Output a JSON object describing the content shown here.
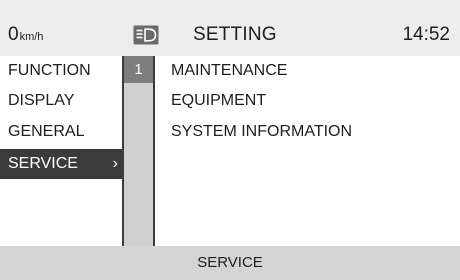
{
  "status": {
    "speed_value": "0",
    "speed_unit": "km/h",
    "headlight_icon": "low-beam-headlight-icon",
    "title": "SETTING",
    "clock": "14:52"
  },
  "categories": [
    {
      "label": "FUNCTION"
    },
    {
      "label": "DISPLAY"
    },
    {
      "label": "GENERAL"
    },
    {
      "label": "SERVICE",
      "selected": true,
      "chevron": "›"
    }
  ],
  "scroll": {
    "page_number": "1"
  },
  "submenu": [
    {
      "label": "MAINTENANCE"
    },
    {
      "label": "EQUIPMENT"
    },
    {
      "label": "SYSTEM INFORMATION"
    }
  ],
  "footer": {
    "label": "SERVICE"
  },
  "colors": {
    "selected_bg": "#3b3b3b",
    "selected_text": "#ffffff",
    "bar_bg": "#ededed",
    "footer_bg": "#d4d4d4",
    "scroll_track": "#d0d0d0",
    "scroll_thumb": "#7d7d7d"
  }
}
